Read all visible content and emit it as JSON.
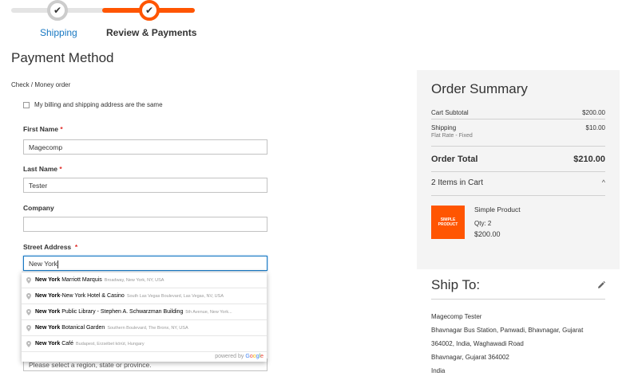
{
  "progress": {
    "steps": [
      {
        "label": "Shipping",
        "status": "complete"
      },
      {
        "label": "Review & Payments",
        "status": "active"
      }
    ],
    "check_glyph": "✔"
  },
  "payment": {
    "section_title": "Payment Method",
    "method_label": "Check / Money order",
    "billing_same_label": "My billing and shipping address are the same",
    "billing_same_checked": false
  },
  "form": {
    "first_name": {
      "label": "First Name",
      "required": "*",
      "value": "Magecomp"
    },
    "last_name": {
      "label": "Last Name",
      "required": "*",
      "value": "Tester"
    },
    "company": {
      "label": "Company",
      "value": ""
    },
    "street": {
      "label": "Street Address",
      "required": "*",
      "value": "New York"
    },
    "region_placeholder": "Please select a region, state or province."
  },
  "autocomplete": {
    "items": [
      {
        "match": "New York",
        "rest": " Marriott Marquis",
        "secondary": "Broadway, New York, NY, USA"
      },
      {
        "match": "New York",
        "rest": "-New York Hotel & Casino",
        "secondary": "South Las Vegas Boulevard, Las Vegas, NV, USA"
      },
      {
        "match": "New York",
        "rest": " Public Library - Stephen A. Schwarzman Building",
        "secondary": "5th Avenue, New York..."
      },
      {
        "match": "New York",
        "rest": " Botanical Garden",
        "secondary": "Southern Boulevard, The Bronx, NY, USA"
      },
      {
        "match": "New York",
        "rest": " Café",
        "secondary": "Budapest, Erzsébet körút, Hungary"
      }
    ],
    "powered_by": "powered by",
    "google": [
      "G",
      "o",
      "o",
      "g",
      "l",
      "e"
    ]
  },
  "summary": {
    "title": "Order Summary",
    "cart_subtotal_label": "Cart Subtotal",
    "cart_subtotal_value": "$200.00",
    "shipping_label": "Shipping",
    "shipping_method": "Flat Rate - Fixed",
    "shipping_value": "$10.00",
    "order_total_label": "Order Total",
    "order_total_value": "$210.00",
    "items_in_cart": "2 Items in Cart",
    "chevron": "^",
    "product": {
      "image_text_1": "SIMPLE",
      "image_text_2": "PRODUCT",
      "name": "Simple Product",
      "qty": "Qty: 2",
      "price": "$200.00"
    }
  },
  "ship_to": {
    "title": "Ship To:",
    "lines": [
      "Magecomp Tester",
      "Bhavnagar Bus Station, Panwadi, Bhavnagar, Gujarat",
      "364002, India, Waghawadi Road",
      "Bhavnagar, Gujarat 364002",
      "India"
    ]
  },
  "colors": {
    "accent": "#ff5501",
    "link": "#1979c3",
    "required": "#e02b27",
    "summary_bg": "#f4f4f4"
  },
  "icons": {
    "check": "check-icon",
    "pin": "map-pin-icon",
    "pencil": "pencil-icon",
    "chevron": "chevron-up-icon"
  }
}
